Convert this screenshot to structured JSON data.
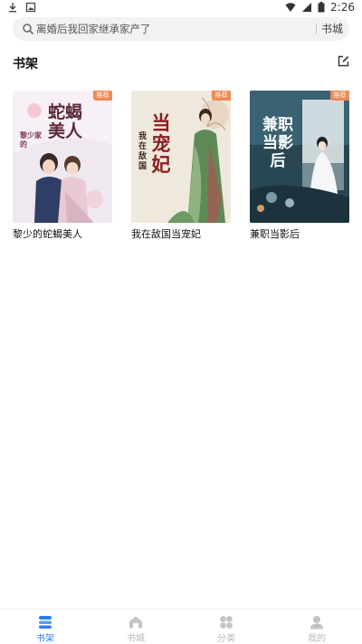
{
  "status_bar": {
    "time": "2:26"
  },
  "search": {
    "placeholder": "离婚后我回家继承家产了",
    "bookstore_label": "书城"
  },
  "header": {
    "title": "书架"
  },
  "books": [
    {
      "title": "黎少的蛇蝎美人",
      "badge": "推荐",
      "cover_title": "蛇蝎美人",
      "cover_subtitle": "黎少家的",
      "cover_bg": "#efe6ee"
    },
    {
      "title": "我在敌国当宠妃",
      "badge": "推荐",
      "cover_title": "当宠妃",
      "cover_subtitle": "我在敌国",
      "cover_bg": "#efe9df"
    },
    {
      "title": "兼职当影后",
      "badge": "推荐",
      "cover_title": "兼职当影后",
      "cover_subtitle": "",
      "cover_bg": "#2b4a57"
    }
  ],
  "nav": [
    {
      "label": "书架",
      "icon": "bookshelf-icon",
      "active": true
    },
    {
      "label": "书城",
      "icon": "bookstore-icon",
      "active": false
    },
    {
      "label": "分类",
      "icon": "category-icon",
      "active": false
    },
    {
      "label": "我的",
      "icon": "profile-icon",
      "active": false
    }
  ],
  "colors": {
    "accent": "#2f7cf6",
    "badge": "#f08a52",
    "search_bg": "#f1f2f4"
  }
}
